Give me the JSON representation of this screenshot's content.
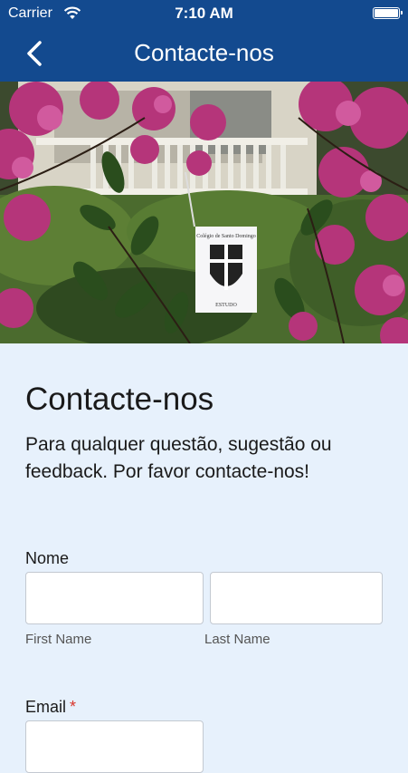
{
  "status_bar": {
    "carrier": "Carrier",
    "time": "7:10 AM"
  },
  "nav": {
    "title": "Contacte-nos",
    "back_icon": "chevron-left-icon"
  },
  "hero": {
    "flag_text": "Colégio de Santo Domingo",
    "flag_sub": "ESTUDO"
  },
  "form": {
    "heading": "Contacte-nos",
    "description": "Para qualquer questão, sugestão ou feedback. Por favor contacte-nos!",
    "name_label": "Nome",
    "first_name_value": "",
    "last_name_value": "",
    "first_name_sublabel": "First Name",
    "last_name_sublabel": "Last Name",
    "email_label": "Email",
    "required_marker": "*"
  },
  "colors": {
    "nav_bg": "#134a8f",
    "page_bg": "#e7f1fc",
    "required": "#d9352b"
  }
}
